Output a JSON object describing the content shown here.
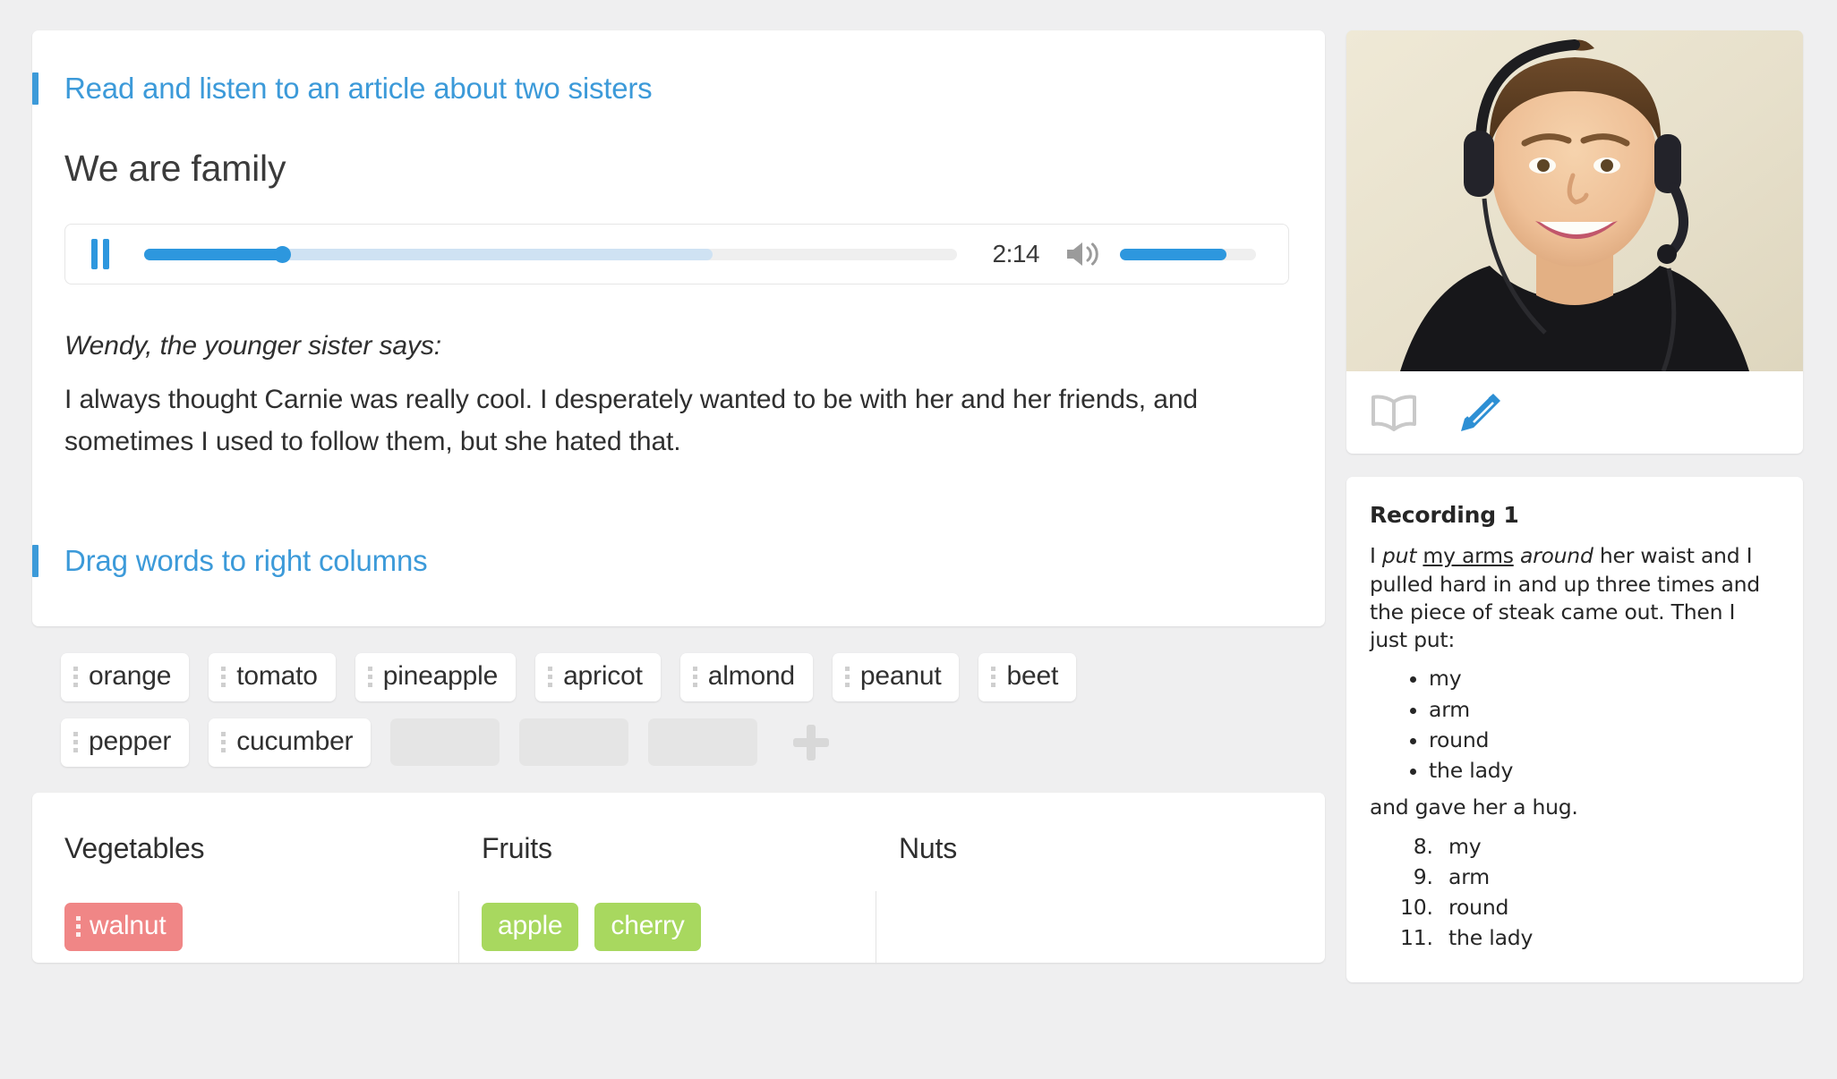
{
  "left": {
    "article_section": {
      "heading": "Read and listen to an article about two sisters",
      "title": "We are family",
      "player": {
        "pause_icon": "pause-icon",
        "current_time": "2:14",
        "progress_percent": 17,
        "buffered_percent": 70,
        "volume_icon": "volume-icon",
        "volume_percent": 78
      },
      "speaker_line": "Wendy, the younger sister says:",
      "body": "I always thought Carnie was really cool. I desperately wanted to be with her and her friends, and sometimes I used to follow them, but she hated that."
    },
    "drag_section": {
      "heading": "Drag words to right columns",
      "handle_icon": "drag-handle-icon",
      "add_icon": "plus-icon",
      "word_bank_rows": [
        [
          "orange",
          "tomato",
          "pineapple",
          "apricot",
          "almond",
          "peanut",
          "beet"
        ],
        [
          "pepper",
          "cucumber"
        ]
      ],
      "empty_slots": 3,
      "columns": [
        {
          "title": "Vegetables",
          "items": [
            {
              "label": "walnut",
              "state": "wrong"
            }
          ]
        },
        {
          "title": "Fruits",
          "items": [
            {
              "label": "apple",
              "state": "right"
            },
            {
              "label": "cherry",
              "state": "right"
            }
          ]
        },
        {
          "title": "Nuts",
          "items": []
        }
      ]
    }
  },
  "right": {
    "video": {
      "label": "teacher-webcam-video",
      "tools": [
        {
          "icon": "book-icon",
          "color": "#c9c9c9"
        },
        {
          "icon": "pencil-edit-icon",
          "color": "#2d8fd4"
        }
      ]
    },
    "recording": {
      "title": "Recording 1",
      "paragraph_parts": [
        {
          "text": "I ",
          "style": "normal"
        },
        {
          "text": "put",
          "style": "italic"
        },
        {
          "text": " ",
          "style": "normal"
        },
        {
          "text": "my arms",
          "style": "underline"
        },
        {
          "text": " ",
          "style": "normal"
        },
        {
          "text": "around",
          "style": "italic"
        },
        {
          "text": " her waist and I pulled hard in and up three times and the piece of steak came out. Then I just put:",
          "style": "normal"
        }
      ],
      "bullets": [
        "my",
        "arm",
        "round",
        "the lady"
      ],
      "tail_text": "and gave her a hug.",
      "ordered_start": 8,
      "ordered_items": [
        "my",
        "arm",
        "round",
        "the lady"
      ]
    }
  },
  "colors": {
    "accent_blue": "#3c9ad9",
    "player_blue": "#2d97de",
    "correct_green": "#a8d85f",
    "wrong_red": "#f08686",
    "page_bg": "#efeff0"
  }
}
